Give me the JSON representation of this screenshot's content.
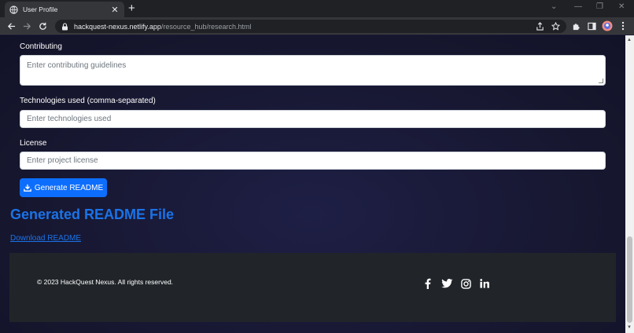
{
  "browser": {
    "tab_title": "User Profile",
    "tab_close": "✕",
    "new_tab": "+",
    "url_host": "hackquest-nexus.netlify.app",
    "url_path": "/resource_hub/research.html"
  },
  "form": {
    "contributing": {
      "label": "Contributing",
      "placeholder": "Enter contributing guidelines"
    },
    "technologies": {
      "label": "Technologies used (comma-separated)",
      "placeholder": "Enter technologies used"
    },
    "license": {
      "label": "License",
      "placeholder": "Enter project license"
    },
    "generate_button": "Generate README"
  },
  "result": {
    "title": "Generated README File",
    "download_link": "Download README"
  },
  "footer": {
    "copyright": "© 2023 HackQuest Nexus. All rights reserved.",
    "socials": [
      "facebook-icon",
      "twitter-icon",
      "instagram-icon",
      "linkedin-icon"
    ]
  },
  "colors": {
    "primary": "#0d6efd",
    "heading": "#1a73e8",
    "footer_bg": "#212529",
    "page_bg": "#1a1a36"
  }
}
